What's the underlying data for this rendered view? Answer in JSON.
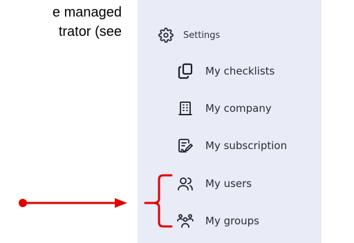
{
  "document": {
    "lines": [
      "e managed",
      "trator (see"
    ]
  },
  "sidebar": {
    "settings": {
      "label": "Settings",
      "icon": "gear-icon"
    },
    "items": [
      {
        "label": "My checklists",
        "icon": "copy-icon"
      },
      {
        "label": "My company",
        "icon": "building-icon"
      },
      {
        "label": "My subscription",
        "icon": "edit-document-icon"
      },
      {
        "label": "My users",
        "icon": "users-icon"
      },
      {
        "label": "My groups",
        "icon": "group-icon"
      }
    ]
  },
  "annotation": {
    "color": "#e00000",
    "shape": "arrow-to-bracket"
  },
  "colors": {
    "sidebar_bg": "#e9ebf6",
    "menu_text": "#2a2d33"
  }
}
